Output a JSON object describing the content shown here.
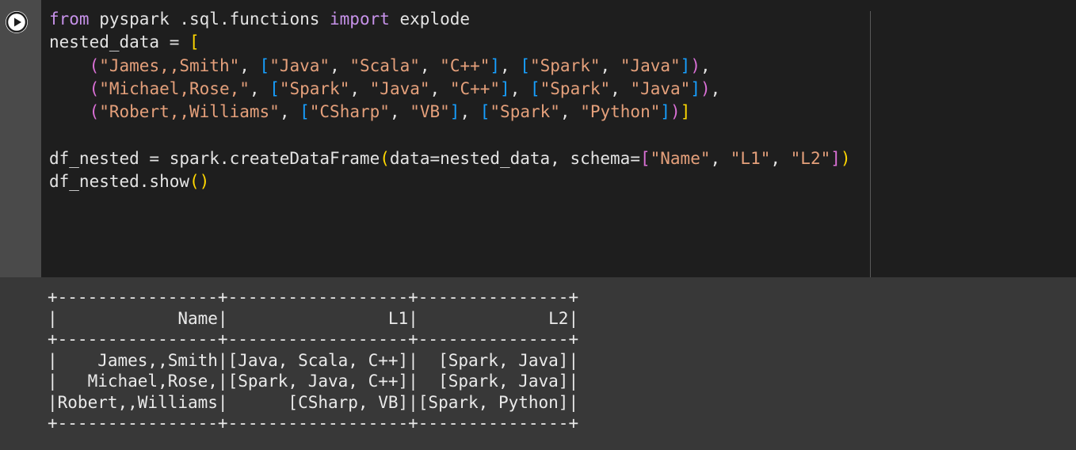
{
  "code_cell": {
    "lines": [
      [
        {
          "t": "from",
          "c": "kw"
        },
        {
          "t": " pyspark .sql.functions "
        },
        {
          "t": "import",
          "c": "kw"
        },
        {
          "t": " explode"
        }
      ],
      [
        {
          "t": "nested_data = "
        },
        {
          "t": "[",
          "c": "p1"
        }
      ],
      [
        {
          "t": "    "
        },
        {
          "t": "(",
          "c": "p2"
        },
        {
          "t": "\"James,,Smith\"",
          "c": "str"
        },
        {
          "t": ", "
        },
        {
          "t": "[",
          "c": "p3"
        },
        {
          "t": "\"Java\"",
          "c": "str"
        },
        {
          "t": ", "
        },
        {
          "t": "\"Scala\"",
          "c": "str"
        },
        {
          "t": ", "
        },
        {
          "t": "\"C++\"",
          "c": "str"
        },
        {
          "t": "]",
          "c": "p3"
        },
        {
          "t": ", "
        },
        {
          "t": "[",
          "c": "p3"
        },
        {
          "t": "\"Spark\"",
          "c": "str"
        },
        {
          "t": ", "
        },
        {
          "t": "\"Java\"",
          "c": "str"
        },
        {
          "t": "]",
          "c": "p3"
        },
        {
          "t": ")",
          "c": "p2"
        },
        {
          "t": ","
        }
      ],
      [
        {
          "t": "    "
        },
        {
          "t": "(",
          "c": "p2"
        },
        {
          "t": "\"Michael,Rose,\"",
          "c": "str"
        },
        {
          "t": ", "
        },
        {
          "t": "[",
          "c": "p3"
        },
        {
          "t": "\"Spark\"",
          "c": "str"
        },
        {
          "t": ", "
        },
        {
          "t": "\"Java\"",
          "c": "str"
        },
        {
          "t": ", "
        },
        {
          "t": "\"C++\"",
          "c": "str"
        },
        {
          "t": "]",
          "c": "p3"
        },
        {
          "t": ", "
        },
        {
          "t": "[",
          "c": "p3"
        },
        {
          "t": "\"Spark\"",
          "c": "str"
        },
        {
          "t": ", "
        },
        {
          "t": "\"Java\"",
          "c": "str"
        },
        {
          "t": "]",
          "c": "p3"
        },
        {
          "t": ")",
          "c": "p2"
        },
        {
          "t": ","
        }
      ],
      [
        {
          "t": "    "
        },
        {
          "t": "(",
          "c": "p2"
        },
        {
          "t": "\"Robert,,Williams\"",
          "c": "str"
        },
        {
          "t": ", "
        },
        {
          "t": "[",
          "c": "p3"
        },
        {
          "t": "\"CSharp\"",
          "c": "str"
        },
        {
          "t": ", "
        },
        {
          "t": "\"VB\"",
          "c": "str"
        },
        {
          "t": "]",
          "c": "p3"
        },
        {
          "t": ", "
        },
        {
          "t": "[",
          "c": "p3"
        },
        {
          "t": "\"Spark\"",
          "c": "str"
        },
        {
          "t": ", "
        },
        {
          "t": "\"Python\"",
          "c": "str"
        },
        {
          "t": "]",
          "c": "p3"
        },
        {
          "t": ")",
          "c": "p2"
        },
        {
          "t": "]",
          "c": "p1"
        }
      ],
      [],
      [
        {
          "t": "df_nested = spark.createDataFrame"
        },
        {
          "t": "(",
          "c": "p1"
        },
        {
          "t": "data=nested_data, schema="
        },
        {
          "t": "[",
          "c": "p2"
        },
        {
          "t": "\"Name\"",
          "c": "str"
        },
        {
          "t": ", "
        },
        {
          "t": "\"L1\"",
          "c": "str"
        },
        {
          "t": ", "
        },
        {
          "t": "\"L2\"",
          "c": "str"
        },
        {
          "t": "]",
          "c": "p2"
        },
        {
          "t": ")",
          "c": "p1"
        }
      ],
      [
        {
          "t": "df_nested.show"
        },
        {
          "t": "()",
          "c": "p1"
        }
      ]
    ]
  },
  "output": {
    "lines": [
      "+----------------+------------------+---------------+",
      "|            Name|                L1|             L2|",
      "+----------------+------------------+---------------+",
      "|    James,,Smith|[Java, Scala, C++]|  [Spark, Java]|",
      "|   Michael,Rose,|[Spark, Java, C++]|  [Spark, Java]|",
      "|Robert,,Williams|      [CSharp, VB]|[Spark, Python]|",
      "+----------------+------------------+---------------+"
    ]
  },
  "colors": {
    "keyword": "#c792ea",
    "string": "#e5a07b",
    "bracket_level1": "#ffd700",
    "bracket_level2": "#da70d6",
    "bracket_level3": "#179fff",
    "code_background": "#1e1e1e",
    "output_background": "#383838"
  },
  "icons": {
    "run": "play-circle-icon"
  }
}
